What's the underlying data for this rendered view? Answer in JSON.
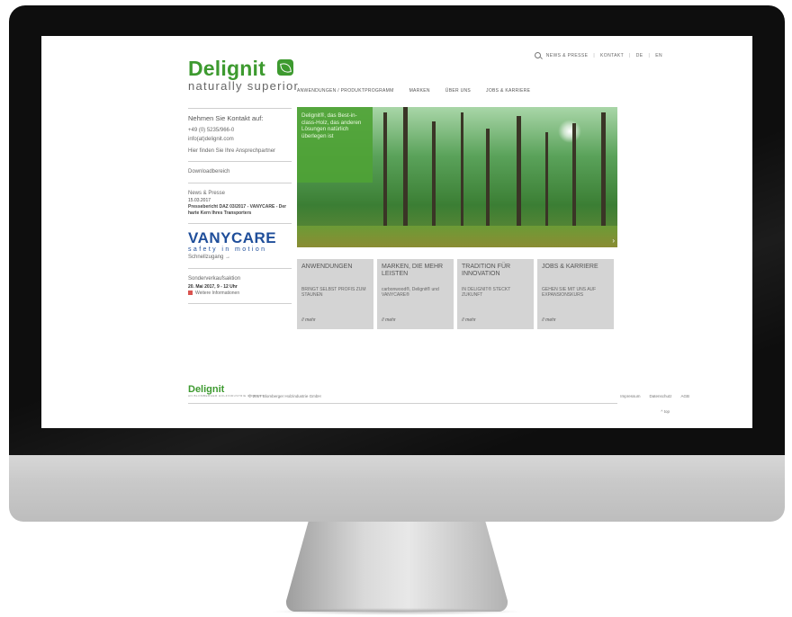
{
  "topnav": {
    "news": "NEWS & PRESSE",
    "contact": "KONTAKT",
    "lang_de": "DE",
    "lang_en": "EN",
    "sep": "|"
  },
  "logo": {
    "name": "Delignit",
    "tagline": "naturally superior"
  },
  "mainnav": [
    "ANWENDUNGEN / PRODUKTPROGRAMM",
    "MARKEN",
    "ÜBER UNS",
    "JOBS & KARRIERE"
  ],
  "sidebar": {
    "contact_heading": "Nehmen Sie Kontakt auf:",
    "phone": "+49 (0) 5235/966-0",
    "email": "info(at)delignit.com",
    "contacts_link": "Hier finden Sie Ihre Ansprechpartner",
    "download": "Downloadbereich",
    "news_heading": "News & Presse",
    "news_date": "15.03.2017",
    "news_text": "Pressebericht DAZ 03/2017 - VANYCARE - Der harte Kern Ihres Transporters",
    "vany_logo": "VANYCARE",
    "vany_sub": "safety in motion",
    "quick": "Schnellzugang →",
    "sale_heading": "Sonderverkaufsaktion",
    "sale_date": "20. Mai 2017, 9 - 12 Uhr",
    "sale_more": "Weitere Informationen"
  },
  "hero": {
    "text": "Delignit®, das Best-in-class-Holz, das anderen Lösungen natürlich überlegen ist",
    "next": "›"
  },
  "tiles": [
    {
      "title": "ANWENDUNGEN",
      "text": "BRINGT SELBST PROFIS ZUM STAUNEN",
      "more": "// mehr"
    },
    {
      "title": "MARKEN, DIE MEHR LEISTEN",
      "text": "carbonwood®, Delignit® und VANYCARE®",
      "more": "// mehr"
    },
    {
      "title": "TRADITION FÜR INNOVATION",
      "text": "IN DELIGNIT® STECKT ZUKUNFT",
      "more": "// mehr"
    },
    {
      "title": "JOBS & KARRIERE",
      "text": "GEHEN SIE MIT UNS AUF EXPANSIONSKURS",
      "more": "// mehr"
    }
  ],
  "footer": {
    "logo": "Delignit",
    "tagline": "AN BLOMBERGER HOLZINDUSTRIE COMPANY",
    "copyright": "© 2017 Blomberger Holzindustrie GmbH",
    "links": [
      "Impressum",
      "Datenschutz",
      "AGB"
    ],
    "top": "^ top"
  },
  "colors": {
    "brand_green": "#3d9a2f",
    "vany_blue": "#1f4e9a",
    "tile_gray": "#d4d4d4"
  }
}
